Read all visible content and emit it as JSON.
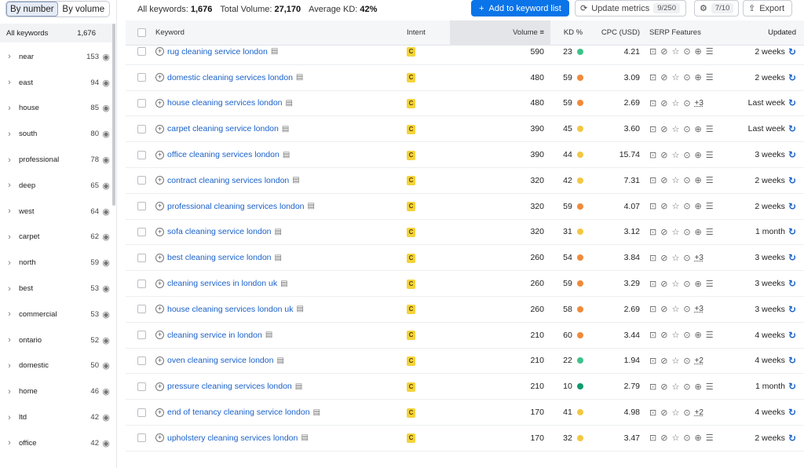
{
  "toggle": {
    "by_number": "By number",
    "by_volume": "By volume"
  },
  "sidebar": {
    "all_label": "All keywords",
    "all_count": "1,676",
    "items": [
      {
        "label": "near",
        "count": "153"
      },
      {
        "label": "east",
        "count": "94"
      },
      {
        "label": "house",
        "count": "85"
      },
      {
        "label": "south",
        "count": "80"
      },
      {
        "label": "professional",
        "count": "78"
      },
      {
        "label": "deep",
        "count": "65"
      },
      {
        "label": "west",
        "count": "64"
      },
      {
        "label": "carpet",
        "count": "62"
      },
      {
        "label": "north",
        "count": "59"
      },
      {
        "label": "best",
        "count": "53"
      },
      {
        "label": "commercial",
        "count": "53"
      },
      {
        "label": "ontario",
        "count": "52"
      },
      {
        "label": "domestic",
        "count": "50"
      },
      {
        "label": "home",
        "count": "46"
      },
      {
        "label": "ltd",
        "count": "42"
      },
      {
        "label": "office",
        "count": "42"
      }
    ]
  },
  "topbar": {
    "all_keywords_label": "All keywords:",
    "all_keywords_value": "1,676",
    "total_volume_label": "Total Volume:",
    "total_volume_value": "27,170",
    "avg_kd_label": "Average KD:",
    "avg_kd_value": "42%",
    "add_btn": "Add to keyword list",
    "update_btn": "Update metrics",
    "update_count": "9/250",
    "settings_count": "7/10",
    "export_btn": "Export"
  },
  "columns": {
    "keyword": "Keyword",
    "intent": "Intent",
    "volume": "Volume",
    "kd": "KD %",
    "cpc": "CPC (USD)",
    "serp": "SERP Features",
    "updated": "Updated"
  },
  "colors": {
    "orange": "#f08a3a",
    "yellow": "#f2c744",
    "green": "#3fc28a",
    "darkgreen": "#0e9a6e",
    "accent": "#0a74e8"
  },
  "rows": [
    {
      "kw": "rug cleaning service london",
      "intent": "C",
      "vol": "590",
      "kd": "23",
      "kdc": "green",
      "cpc": "4.21",
      "serp": "",
      "upd": "2 weeks"
    },
    {
      "kw": "domestic cleaning services london",
      "intent": "C",
      "vol": "480",
      "kd": "59",
      "kdc": "orange",
      "cpc": "3.09",
      "serp": "",
      "upd": "2 weeks"
    },
    {
      "kw": "house cleaning services london",
      "intent": "C",
      "vol": "480",
      "kd": "59",
      "kdc": "orange",
      "cpc": "2.69",
      "serp": "+3",
      "upd": "Last week"
    },
    {
      "kw": "carpet cleaning service london",
      "intent": "C",
      "vol": "390",
      "kd": "45",
      "kdc": "yellow",
      "cpc": "3.60",
      "serp": "",
      "upd": "Last week"
    },
    {
      "kw": "office cleaning services london",
      "intent": "C",
      "vol": "390",
      "kd": "44",
      "kdc": "yellow",
      "cpc": "15.74",
      "serp": "",
      "upd": "3 weeks"
    },
    {
      "kw": "contract cleaning services london",
      "intent": "C",
      "vol": "320",
      "kd": "42",
      "kdc": "yellow",
      "cpc": "7.31",
      "serp": "",
      "upd": "2 weeks"
    },
    {
      "kw": "professional cleaning services london",
      "intent": "C",
      "vol": "320",
      "kd": "59",
      "kdc": "orange",
      "cpc": "4.07",
      "serp": "",
      "upd": "2 weeks"
    },
    {
      "kw": "sofa cleaning service london",
      "intent": "C",
      "vol": "320",
      "kd": "31",
      "kdc": "yellow",
      "cpc": "3.12",
      "serp": "",
      "upd": "1 month"
    },
    {
      "kw": "best cleaning service london",
      "intent": "C",
      "vol": "260",
      "kd": "54",
      "kdc": "orange",
      "cpc": "3.84",
      "serp": "+3",
      "upd": "3 weeks"
    },
    {
      "kw": "cleaning services in london uk",
      "intent": "C",
      "vol": "260",
      "kd": "59",
      "kdc": "orange",
      "cpc": "3.29",
      "serp": "",
      "upd": "3 weeks"
    },
    {
      "kw": "house cleaning services london uk",
      "intent": "C",
      "vol": "260",
      "kd": "58",
      "kdc": "orange",
      "cpc": "2.69",
      "serp": "+3",
      "upd": "3 weeks"
    },
    {
      "kw": "cleaning service in london",
      "intent": "C",
      "vol": "210",
      "kd": "60",
      "kdc": "orange",
      "cpc": "3.44",
      "serp": "",
      "upd": "4 weeks"
    },
    {
      "kw": "oven cleaning service london",
      "intent": "C",
      "vol": "210",
      "kd": "22",
      "kdc": "green",
      "cpc": "1.94",
      "serp": "+2",
      "upd": "4 weeks"
    },
    {
      "kw": "pressure cleaning services london",
      "intent": "C",
      "vol": "210",
      "kd": "10",
      "kdc": "darkgreen",
      "cpc": "2.79",
      "serp": "",
      "upd": "1 month"
    },
    {
      "kw": "end of tenancy cleaning service london",
      "intent": "C",
      "vol": "170",
      "kd": "41",
      "kdc": "yellow",
      "cpc": "4.98",
      "serp": "+2",
      "upd": "4 weeks"
    },
    {
      "kw": "upholstery cleaning services london",
      "intent": "C",
      "vol": "170",
      "kd": "32",
      "kdc": "yellow",
      "cpc": "3.47",
      "serp": "",
      "upd": "2 weeks"
    }
  ]
}
